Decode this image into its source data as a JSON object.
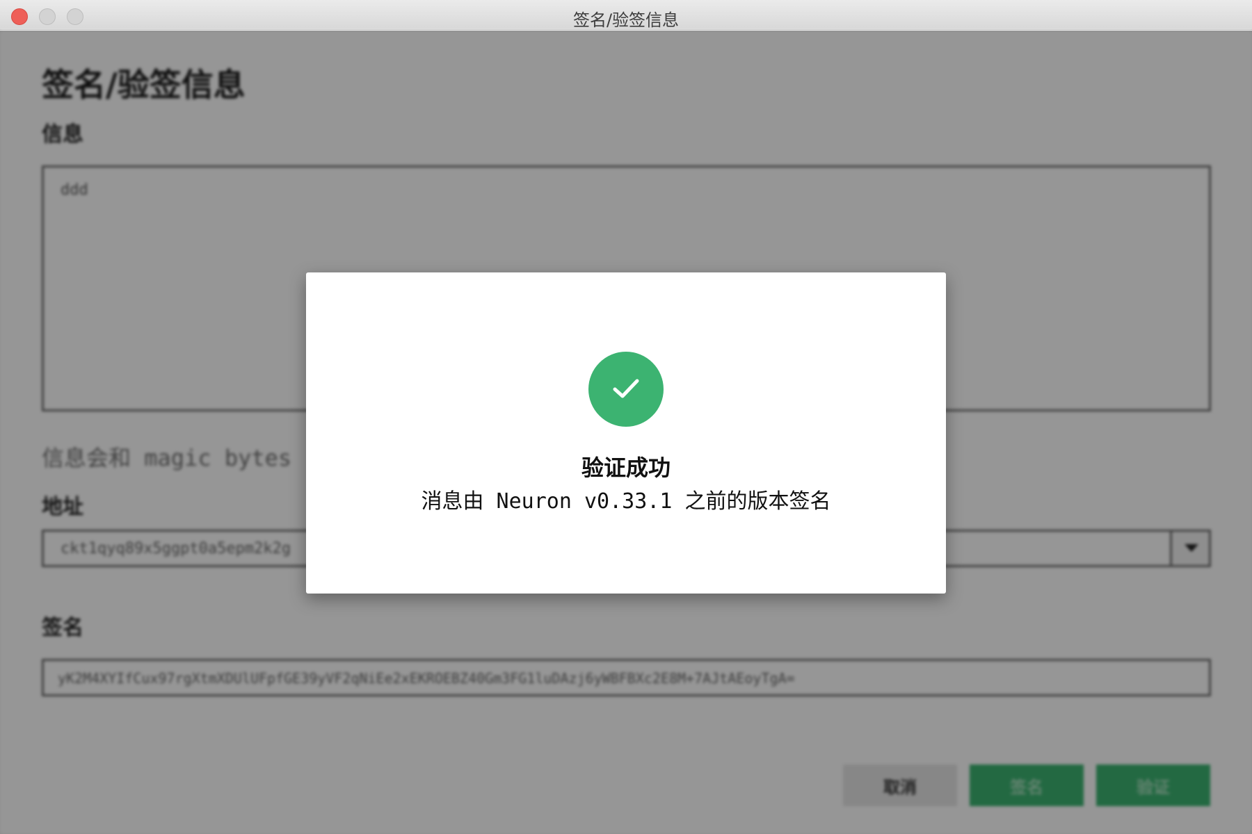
{
  "window": {
    "title": "签名/验签信息"
  },
  "page": {
    "title": "签名/验签信息",
    "message_label": "信息",
    "message_value": "ddd",
    "hint": "信息会和 magic bytes",
    "address_label": "地址",
    "address_value": "ckt1qyq89x5ggpt0a5epm2k2g",
    "signature_label": "签名",
    "signature_value": "yK2M4XYIfCux97rgXtmXDUlUFpfGE39yVF2qNiEe2xEKROEBZ40Gm3FG1luDAzj6yWBFBXc2E8M+7AJtAEoyTgA="
  },
  "actions": {
    "cancel_label": "取消",
    "sign_label": "签名",
    "verify_label": "验证"
  },
  "modal": {
    "icon": "checkmark-icon",
    "title": "验证成功",
    "message": "消息由 Neuron v0.33.1 之前的版本签名"
  },
  "colors": {
    "accent": "#3cb371",
    "close": "#ee5f58"
  }
}
